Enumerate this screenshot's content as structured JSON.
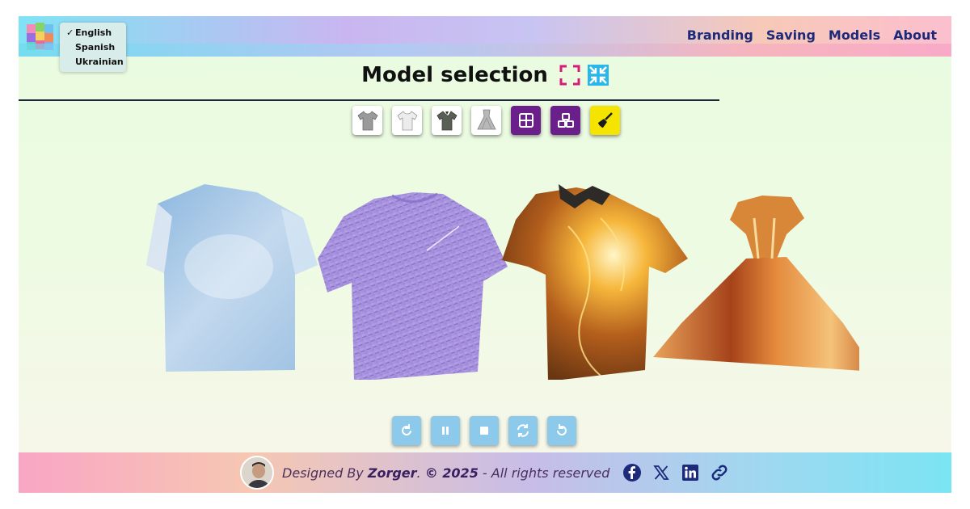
{
  "header": {
    "nav": [
      "Branding",
      "Saving",
      "Models",
      "About"
    ],
    "language_menu": {
      "items": [
        "English",
        "Spanish",
        "Ukrainian"
      ],
      "selected": "English",
      "check_mark": "✓"
    }
  },
  "main": {
    "title": "Model selection",
    "title_icons": [
      "fullscreen-enter-icon",
      "fullscreen-exit-icon"
    ],
    "toolbar": [
      {
        "name": "tshirt-gray-icon",
        "style": "white"
      },
      {
        "name": "tshirt-white-icon",
        "style": "white"
      },
      {
        "name": "polo-shirt-icon",
        "style": "white"
      },
      {
        "name": "dress-icon",
        "style": "white"
      },
      {
        "name": "grid-view-icon",
        "style": "purple"
      },
      {
        "name": "cubes-icon",
        "style": "purple"
      },
      {
        "name": "broom-icon",
        "style": "yellow"
      }
    ],
    "models": [
      "sky-tshirt",
      "lavender-tshirt",
      "fire-polo",
      "orange-dress"
    ],
    "controls": [
      "rotate-right-icon",
      "pause-icon",
      "stop-icon",
      "refresh-icon",
      "rotate-left-icon"
    ]
  },
  "footer": {
    "credit_prefix": "Designed By ",
    "author": "Zorger",
    "separator": ". ",
    "copyright": "© 2025",
    "suffix": " - All rights reserved",
    "socials": [
      "facebook-icon",
      "x-icon",
      "linkedin-icon",
      "link-icon"
    ]
  },
  "colors": {
    "nav_text": "#1d2a7a",
    "toolbar_purple": "#6a1f8a",
    "toolbar_yellow": "#f5e400",
    "control_blue": "#8cc9ea"
  }
}
